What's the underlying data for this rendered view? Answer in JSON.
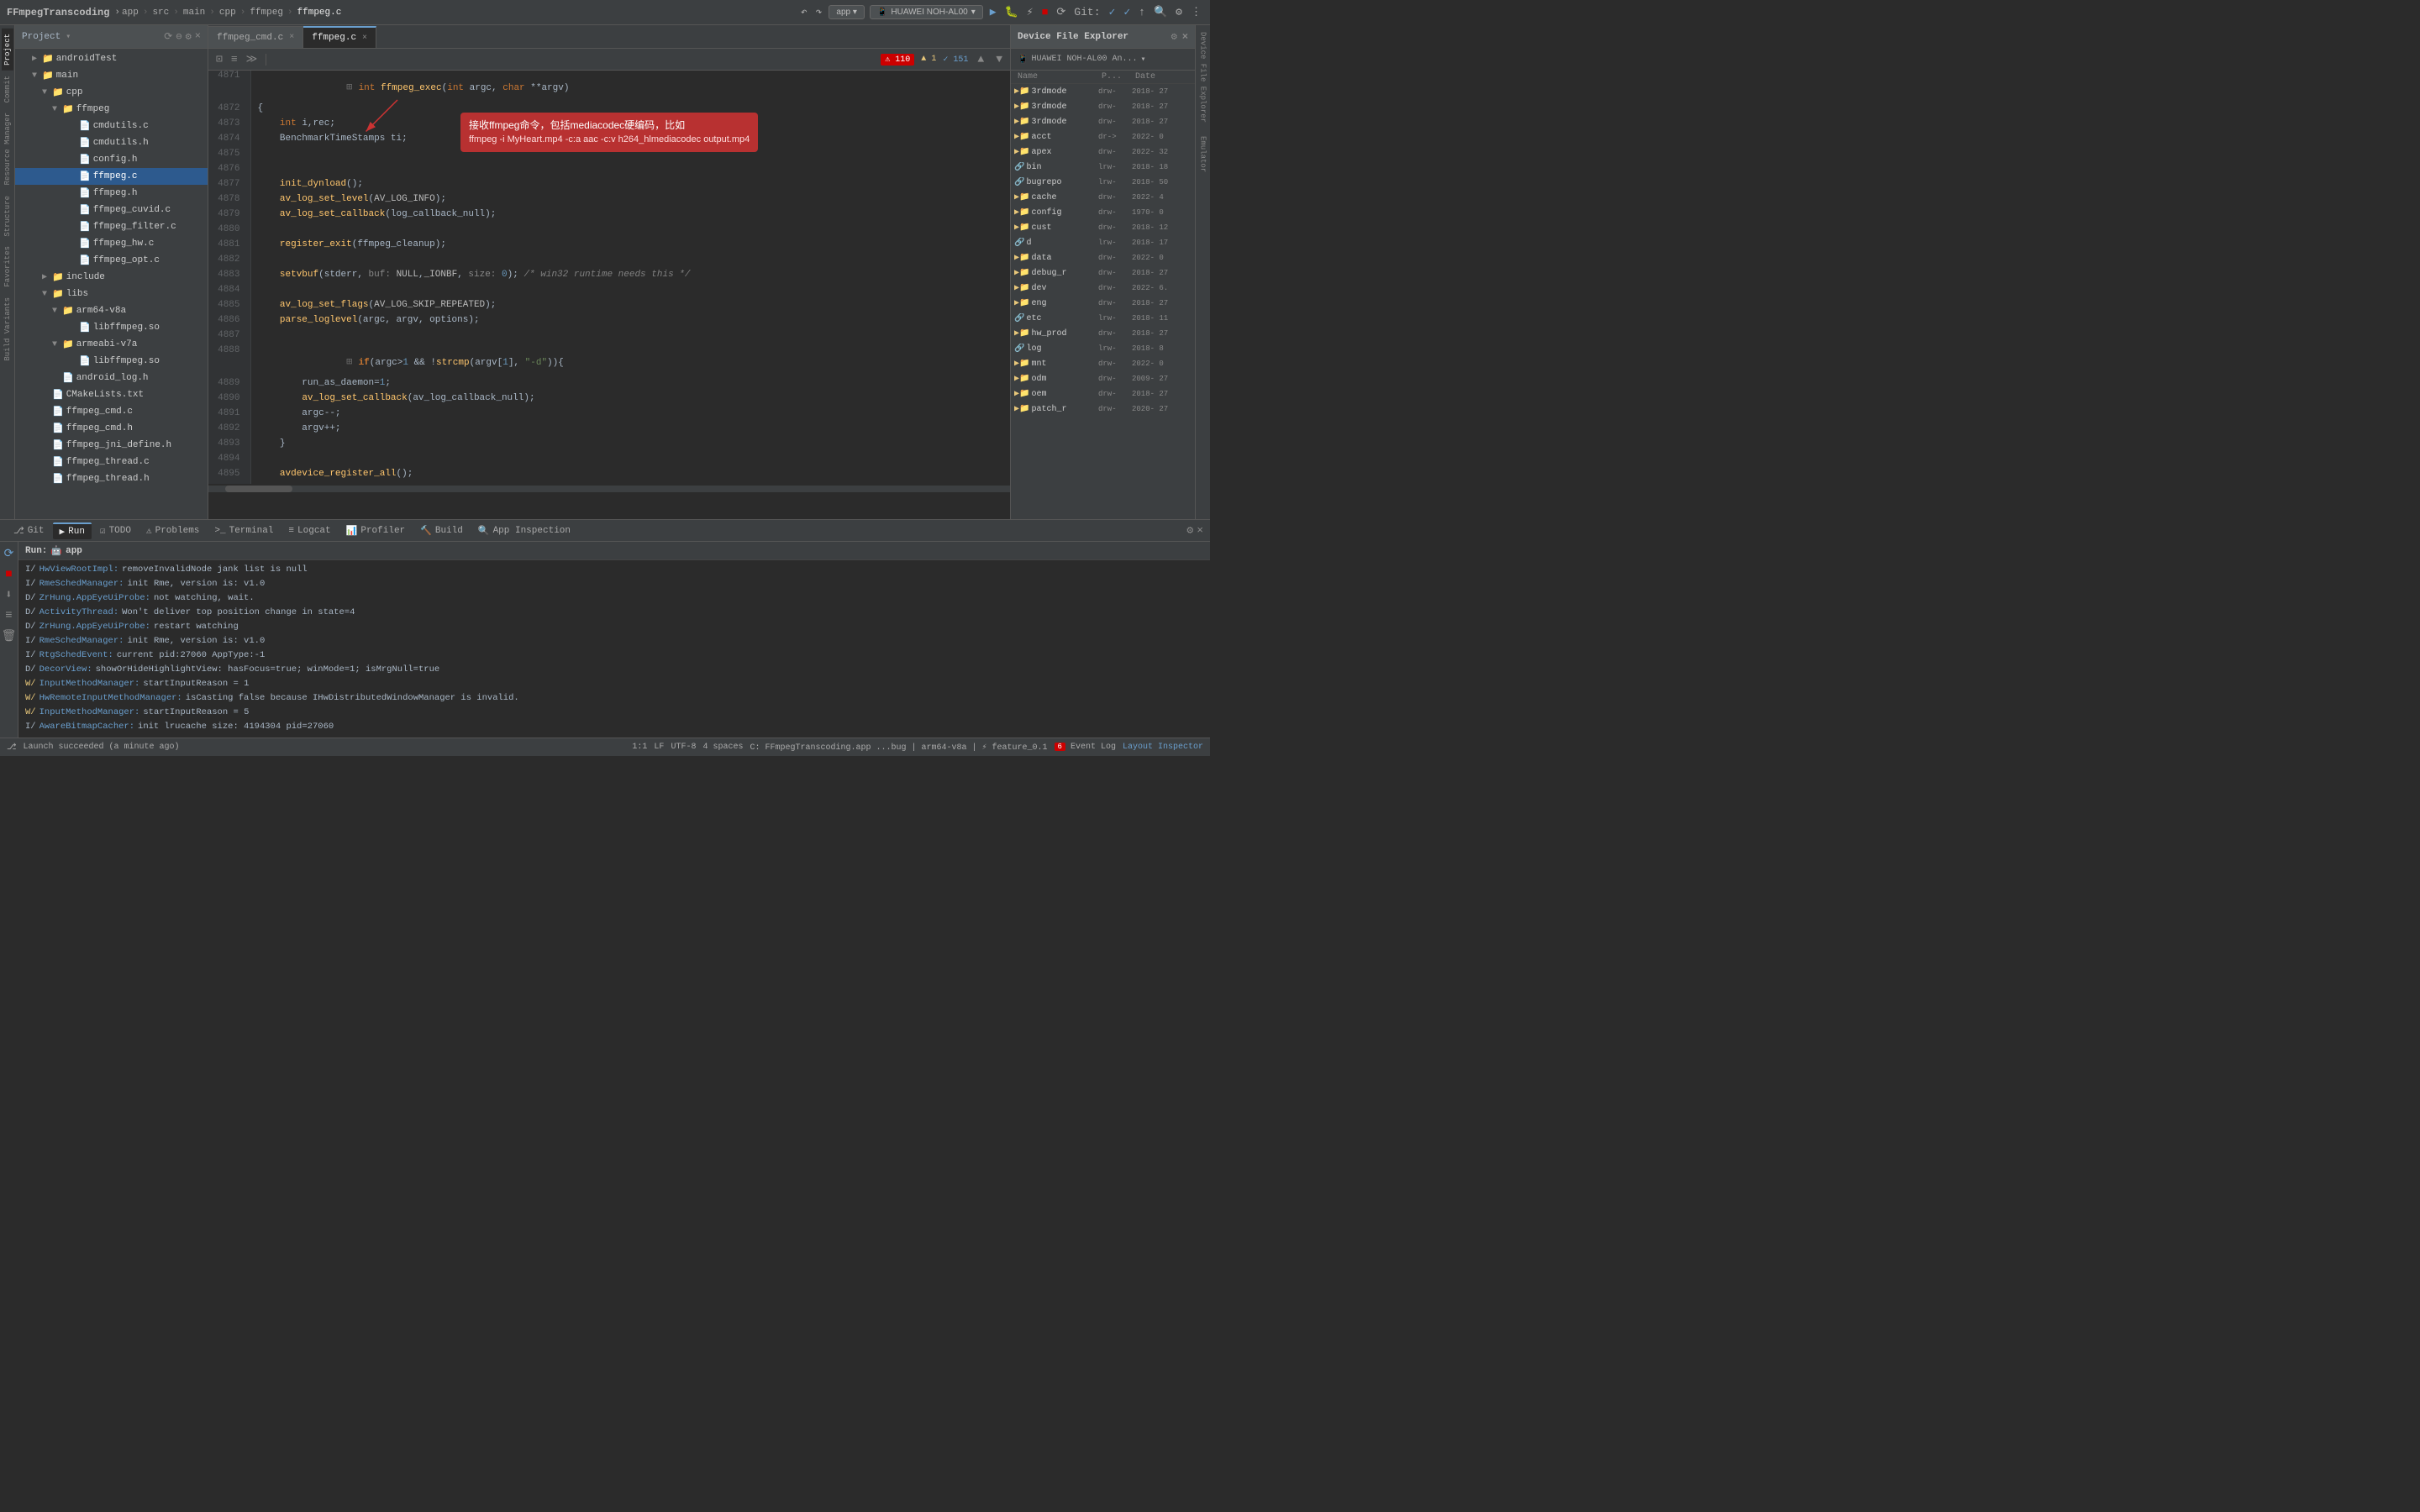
{
  "topbar": {
    "title": "FFmpegTranscoding",
    "breadcrumb": [
      "FFmpegTranscoding",
      "app",
      "src",
      "main",
      "cpp",
      "ffmpeg",
      "ffmpeg.c"
    ],
    "device": "HUAWEI NOH-AL00",
    "run_config": "app",
    "git_label": "Git:"
  },
  "sidebar": {
    "title": "Project",
    "items": [
      {
        "id": "androidtest",
        "label": "androidTest",
        "type": "folder",
        "indent": 2,
        "open": false
      },
      {
        "id": "main",
        "label": "main",
        "type": "folder",
        "indent": 2,
        "open": true
      },
      {
        "id": "cpp",
        "label": "cpp",
        "type": "folder",
        "indent": 3,
        "open": true
      },
      {
        "id": "ffmpeg",
        "label": "ffmpeg",
        "type": "folder",
        "indent": 4,
        "open": true
      },
      {
        "id": "cmdutils_c",
        "label": "cmdutils.c",
        "type": "file_c",
        "indent": 5
      },
      {
        "id": "cmdutils_h",
        "label": "cmdutils.h",
        "type": "file_h",
        "indent": 5
      },
      {
        "id": "config_h",
        "label": "config.h",
        "type": "file_h",
        "indent": 5
      },
      {
        "id": "ffmpeg_c",
        "label": "ffmpeg.c",
        "type": "file_c",
        "indent": 5,
        "selected": true
      },
      {
        "id": "ffmpeg_h",
        "label": "ffmpeg.h",
        "type": "file_h",
        "indent": 5
      },
      {
        "id": "ffmpeg_cuvid_c",
        "label": "ffmpeg_cuvid.c",
        "type": "file_c",
        "indent": 5
      },
      {
        "id": "ffmpeg_filter_c",
        "label": "ffmpeg_filter.c",
        "type": "file_c",
        "indent": 5
      },
      {
        "id": "ffmpeg_hw_c",
        "label": "ffmpeg_hw.c",
        "type": "file_c",
        "indent": 5
      },
      {
        "id": "ffmpeg_opt_c",
        "label": "ffmpeg_opt.c",
        "type": "file_c",
        "indent": 5
      },
      {
        "id": "include",
        "label": "include",
        "type": "folder",
        "indent": 3,
        "open": false
      },
      {
        "id": "libs",
        "label": "libs",
        "type": "folder",
        "indent": 3,
        "open": true
      },
      {
        "id": "arm64v8a",
        "label": "arm64-v8a",
        "type": "folder",
        "indent": 4,
        "open": true
      },
      {
        "id": "libffmpeg_so1",
        "label": "libffmpeg.so",
        "type": "file_so",
        "indent": 5
      },
      {
        "id": "armeabiv7a",
        "label": "armeabi-v7a",
        "type": "folder",
        "indent": 4,
        "open": true
      },
      {
        "id": "libffmpeg_so2",
        "label": "libffmpeg.so",
        "type": "file_so",
        "indent": 5
      },
      {
        "id": "android_log_h",
        "label": "android_log.h",
        "type": "file_h",
        "indent": 4
      },
      {
        "id": "cmakelists",
        "label": "CMakeLists.txt",
        "type": "file_txt",
        "indent": 3
      },
      {
        "id": "ffmpeg_cmd_c",
        "label": "ffmpeg_cmd.c",
        "type": "file_c",
        "indent": 3
      },
      {
        "id": "ffmpeg_cmd_h",
        "label": "ffmpeg_cmd.h",
        "type": "file_h",
        "indent": 3
      },
      {
        "id": "ffmpeg_jni_define_h",
        "label": "ffmpeg_jni_define.h",
        "type": "file_h",
        "indent": 3
      },
      {
        "id": "ffmpeg_thread_c",
        "label": "ffmpeg_thread.c",
        "type": "file_c",
        "indent": 3
      },
      {
        "id": "ffmpeg_thread_h",
        "label": "ffmpeg_thread.h",
        "type": "file_h",
        "indent": 3
      }
    ]
  },
  "tabs": [
    {
      "id": "ffmpeg_cmd_c_tab",
      "label": "ffmpeg_cmd.c",
      "active": false,
      "closeable": true
    },
    {
      "id": "ffmpeg_c_tab",
      "label": "ffmpeg.c",
      "active": true,
      "closeable": true
    }
  ],
  "editor": {
    "error_count": "110",
    "warning_count": "1",
    "ok_count": "151",
    "lines": [
      {
        "num": "4871",
        "code": "int ffmpeg_exec(int argc, char **argv)",
        "has_arrow": true
      },
      {
        "num": "4872",
        "code": "{"
      },
      {
        "num": "4873",
        "code": "    int i,rec;"
      },
      {
        "num": "4874",
        "code": "    BenchmarkTimeStamps ti;"
      },
      {
        "num": "4875",
        "code": ""
      },
      {
        "num": "4876",
        "code": ""
      },
      {
        "num": "4877",
        "code": "    init_dynload();"
      },
      {
        "num": "4878",
        "code": "    av_log_set_level(AV_LOG_INFO);"
      },
      {
        "num": "4879",
        "code": "    av_log_set_callback(log_callback_null);"
      },
      {
        "num": "4880",
        "code": ""
      },
      {
        "num": "4881",
        "code": "    register_exit(ffmpeg_cleanup);"
      },
      {
        "num": "4882",
        "code": ""
      },
      {
        "num": "4883",
        "code": "    setvbuf(stderr, buf: NULL, _IONBF, size: 0); /* win32 runtime needs this */"
      },
      {
        "num": "4884",
        "code": ""
      },
      {
        "num": "4885",
        "code": "    av_log_set_flags(AV_LOG_SKIP_REPEATED);"
      },
      {
        "num": "4886",
        "code": "    parse_loglevel(argc, argv, options);"
      },
      {
        "num": "4887",
        "code": ""
      },
      {
        "num": "4888",
        "code": "    if(argc>1 && !strcmp(argv[1], \"-d\")){"
      },
      {
        "num": "4889",
        "code": "        run_as_daemon=1;"
      },
      {
        "num": "4890",
        "code": "        av_log_set_callback(av_log_callback_null);"
      },
      {
        "num": "4891",
        "code": "        argc--;"
      },
      {
        "num": "4892",
        "code": "        argv++;"
      },
      {
        "num": "4893",
        "code": "    }"
      },
      {
        "num": "4894",
        "code": ""
      },
      {
        "num": "4895",
        "code": "    avdevice_register_all();"
      }
    ],
    "annotation": {
      "title": "接收ffmpeg命令，包括mediacodec硬编码，比如",
      "subtitle": "ffmpeg -i MyHeart.mp4 -c:a aac -c:v h264_hlmediacodec output.mp4"
    }
  },
  "file_explorer": {
    "title": "Device File Explorer",
    "device": "HUAWEI NOH-AL00 An...",
    "columns": [
      "Name",
      "P...",
      "Date"
    ],
    "items": [
      {
        "name": "3rdmode",
        "perm": "drw-",
        "date": "2018- 27",
        "indent": 1,
        "type": "folder"
      },
      {
        "name": "3rdmode",
        "perm": "drw-",
        "date": "2018- 27",
        "indent": 1,
        "type": "folder"
      },
      {
        "name": "3rdmode",
        "perm": "drw-",
        "date": "2018- 27",
        "indent": 1,
        "type": "folder"
      },
      {
        "name": "acct",
        "perm": "dr->",
        "date": "2022- 0",
        "indent": 1,
        "type": "folder"
      },
      {
        "name": "apex",
        "perm": "drw-",
        "date": "2022- 32",
        "indent": 1,
        "type": "folder"
      },
      {
        "name": "bin",
        "perm": "lrw-",
        "date": "2018- 18",
        "indent": 1,
        "type": "link"
      },
      {
        "name": "bugrepo",
        "perm": "lrw-",
        "date": "2018- 50",
        "indent": 1,
        "type": "link"
      },
      {
        "name": "cache",
        "perm": "drw-",
        "date": "2022- 4",
        "indent": 1,
        "type": "folder"
      },
      {
        "name": "config",
        "perm": "drw-",
        "date": "1970- 0",
        "indent": 1,
        "type": "folder"
      },
      {
        "name": "cust",
        "perm": "drw-",
        "date": "2018- 12",
        "indent": 1,
        "type": "folder"
      },
      {
        "name": "d",
        "perm": "lrw-",
        "date": "2018- 17",
        "indent": 1,
        "type": "link"
      },
      {
        "name": "data",
        "perm": "drw-",
        "date": "2022- 0",
        "indent": 1,
        "type": "folder"
      },
      {
        "name": "debug_r",
        "perm": "drw-",
        "date": "2018- 27",
        "indent": 1,
        "type": "folder"
      },
      {
        "name": "dev",
        "perm": "drw-",
        "date": "2022- 6.",
        "indent": 1,
        "type": "folder"
      },
      {
        "name": "eng",
        "perm": "drw-",
        "date": "2018- 27",
        "indent": 1,
        "type": "folder"
      },
      {
        "name": "etc",
        "perm": "lrw-",
        "date": "2018- 11",
        "indent": 1,
        "type": "link"
      },
      {
        "name": "hw_prod",
        "perm": "drw-",
        "date": "2018- 27",
        "indent": 1,
        "type": "folder"
      },
      {
        "name": "log",
        "perm": "lrw-",
        "date": "2018- 8",
        "indent": 1,
        "type": "link"
      },
      {
        "name": "mnt",
        "perm": "drw-",
        "date": "2022- 0",
        "indent": 1,
        "type": "folder"
      },
      {
        "name": "odm",
        "perm": "drw-",
        "date": "2009- 27",
        "indent": 1,
        "type": "folder"
      },
      {
        "name": "oem",
        "perm": "drw-",
        "date": "2018- 27",
        "indent": 1,
        "type": "folder"
      },
      {
        "name": "patch_r",
        "perm": "drw-",
        "date": "2020- 27",
        "indent": 1,
        "type": "folder"
      }
    ]
  },
  "run_panel": {
    "title": "Run:",
    "app_label": "app",
    "logs": [
      {
        "level": "I",
        "tag": "HwViewRootImpl",
        "msg": "removeInvalidNode jank list is null"
      },
      {
        "level": "I",
        "tag": "RmeSchedManager",
        "msg": "init Rme, version is: v1.0"
      },
      {
        "level": "D",
        "tag": "ZrHung.AppEyeUiProbe",
        "msg": "not watching, wait."
      },
      {
        "level": "D",
        "tag": "ActivityThread",
        "msg": "Won't deliver top position change in state=4"
      },
      {
        "level": "D",
        "tag": "ZrHung.AppEyeUiProbe",
        "msg": "restart watching"
      },
      {
        "level": "I",
        "tag": "RmeSchedManager",
        "msg": "init Rme, version is: v1.0"
      },
      {
        "level": "I",
        "tag": "RtgSchedEvent",
        "msg": "current pid:27060 AppType:-1"
      },
      {
        "level": "D",
        "tag": "DecorView",
        "msg": "showOrHideHighlightView: hasFocus=true; winMode=1; isMrgNull=true"
      },
      {
        "level": "W",
        "tag": "InputMethodManager",
        "msg": "startInputReason = 1"
      },
      {
        "level": "W",
        "tag": "HwRemoteInputMethodManager",
        "msg": "isCasting false because IHwDistributedWindowManager is invalid."
      },
      {
        "level": "W",
        "tag": "InputMethodManager",
        "msg": "startInputReason = 5"
      },
      {
        "level": "I",
        "tag": "AwareBitmapCacher",
        "msg": "init lrucache size: 4194304 pid=27060"
      }
    ]
  },
  "bottom_tabs": [
    {
      "id": "git",
      "label": "Git",
      "icon": "⎇",
      "active": false
    },
    {
      "id": "run",
      "label": "Run",
      "icon": "▶",
      "active": true
    },
    {
      "id": "todo",
      "label": "TODO",
      "icon": "☑",
      "active": false
    },
    {
      "id": "problems",
      "label": "Problems",
      "icon": "⚠",
      "active": false
    },
    {
      "id": "terminal",
      "label": "Terminal",
      "icon": ">_",
      "active": false
    },
    {
      "id": "logcat",
      "label": "Logcat",
      "icon": "≡",
      "active": false
    },
    {
      "id": "profiler",
      "label": "Profiler",
      "icon": "📊",
      "active": false
    },
    {
      "id": "build",
      "label": "Build",
      "icon": "🔨",
      "active": false
    },
    {
      "id": "app_inspection",
      "label": "App Inspection",
      "icon": "🔍",
      "active": false
    }
  ],
  "status_bar": {
    "git_icon": "⎇",
    "git_branch": "Git",
    "run_status": "Launch succeeded (a minute ago)",
    "position": "1:1",
    "lf": "LF",
    "encoding": "UTF-8",
    "indent": "4 spaces",
    "context": "C: FFmpegTranscoding.app ...bug | arm64-v8a | ⚡ feature_0.1",
    "event_log_count": "6",
    "event_log_label": "Event Log",
    "layout_inspector": "Layout Inspector"
  },
  "left_tabs": [
    {
      "id": "project",
      "label": "Project",
      "active": true
    },
    {
      "id": "commit",
      "label": "Commit",
      "active": false
    },
    {
      "id": "resource_manager",
      "label": "Resource Manager",
      "active": false
    },
    {
      "id": "structure",
      "label": "Structure",
      "active": false
    },
    {
      "id": "favorites",
      "label": "Favorites",
      "active": false
    },
    {
      "id": "build_variants",
      "label": "Build Variants",
      "active": false
    }
  ],
  "right_tabs": [
    {
      "id": "device_file_explorer",
      "label": "Device File Explorer",
      "active": true
    },
    {
      "id": "emulator",
      "label": "Emulator",
      "active": false
    }
  ]
}
